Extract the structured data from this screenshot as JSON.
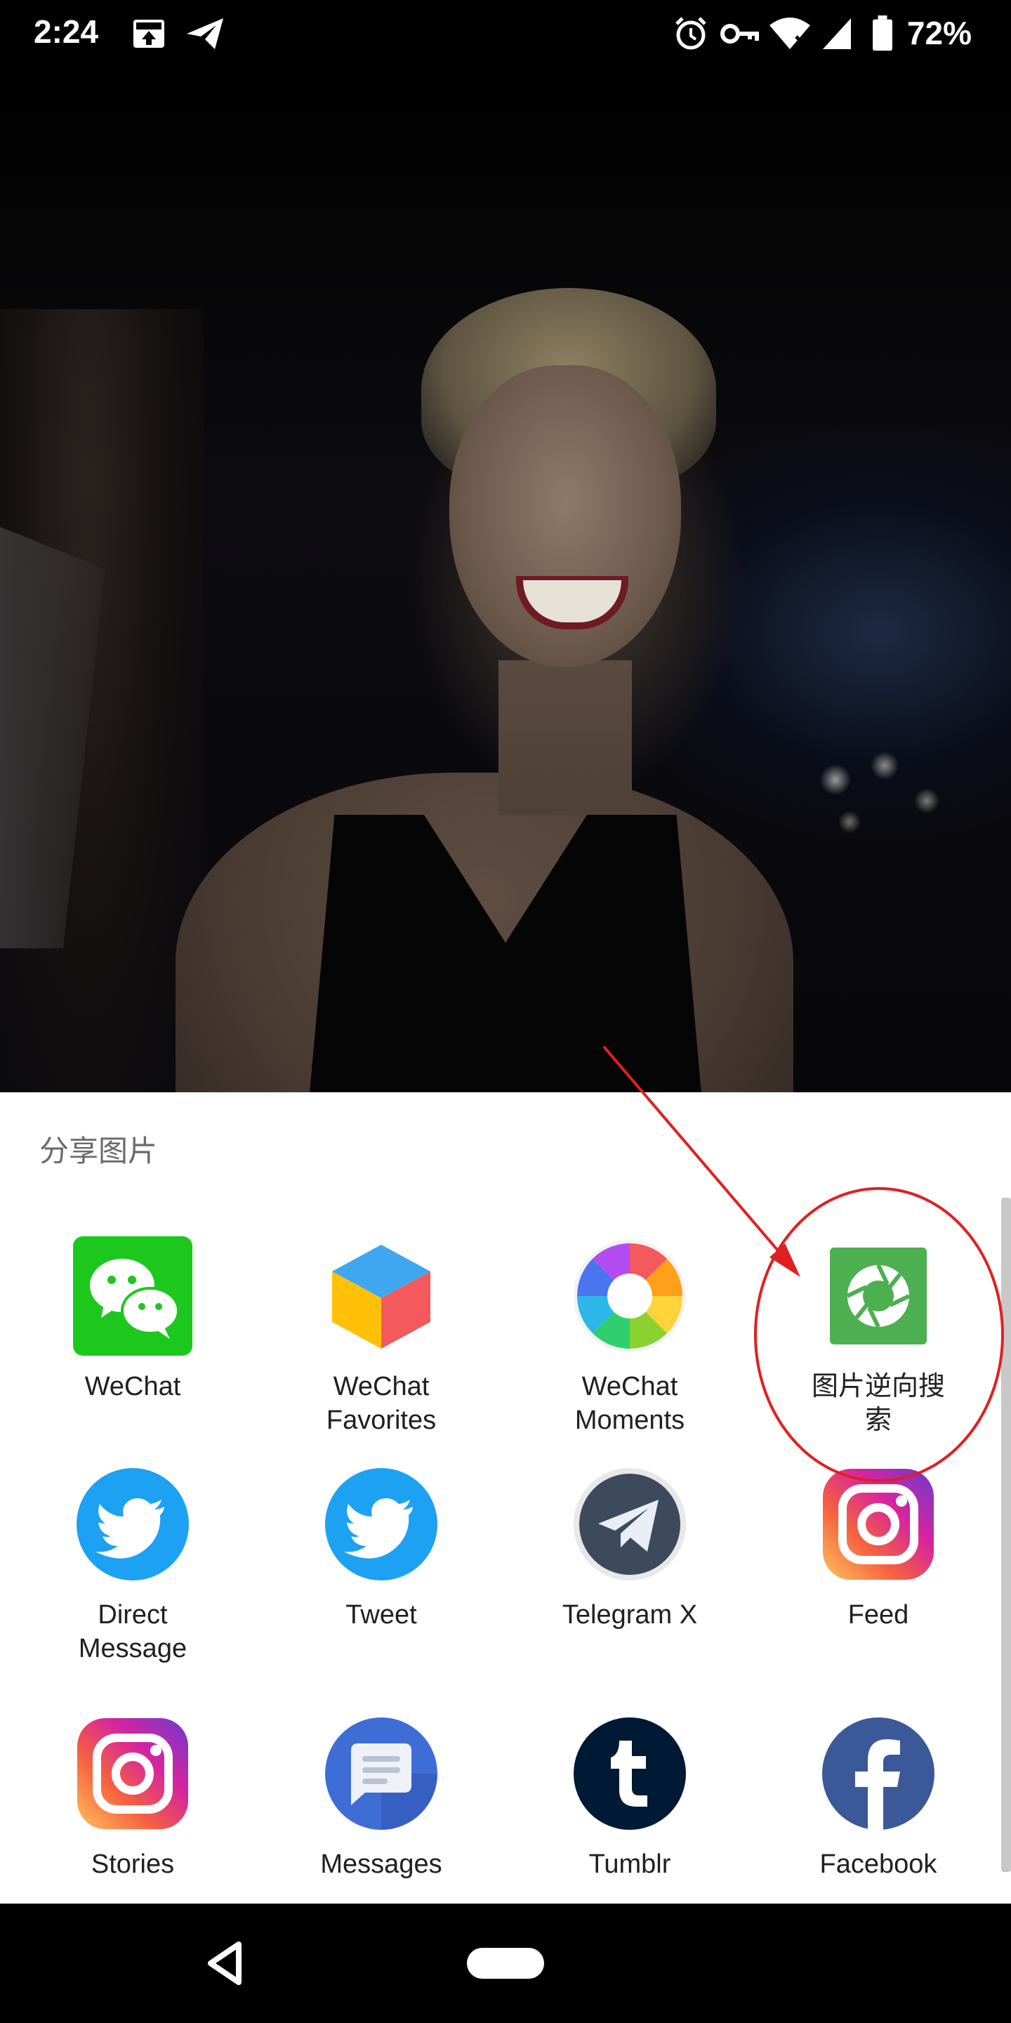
{
  "status_bar": {
    "time": "2:24",
    "battery_percent": "72%",
    "icons": [
      "upload-icon",
      "send-icon",
      "alarm-icon",
      "vpn-key-icon",
      "wifi-icon",
      "signal-icon",
      "battery-icon"
    ]
  },
  "share_sheet": {
    "title": "分享图片",
    "apps": [
      {
        "label": "WeChat",
        "icon": "wechat-icon"
      },
      {
        "label": "WeChat\nFavorites",
        "icon": "wechat-favorites-icon"
      },
      {
        "label": "WeChat\nMoments",
        "icon": "wechat-moments-icon"
      },
      {
        "label": "图片逆向搜\n索",
        "icon": "reverse-image-search-icon"
      },
      {
        "label": "Direct\nMessage",
        "icon": "twitter-icon"
      },
      {
        "label": "Tweet",
        "icon": "twitter-icon"
      },
      {
        "label": "Telegram X",
        "icon": "telegram-icon"
      },
      {
        "label": "Feed",
        "icon": "instagram-icon"
      },
      {
        "label": "Stories",
        "icon": "instagram-icon"
      },
      {
        "label": "Messages",
        "icon": "messages-icon"
      },
      {
        "label": "Tumblr",
        "icon": "tumblr-icon"
      },
      {
        "label": "Facebook",
        "icon": "facebook-icon"
      }
    ]
  },
  "colors": {
    "annotation_red": "#e02020",
    "wechat_green": "#1dc81d",
    "twitter_blue": "#1da1f2",
    "facebook_blue": "#3b5998",
    "tumblr_navy": "#001935"
  }
}
